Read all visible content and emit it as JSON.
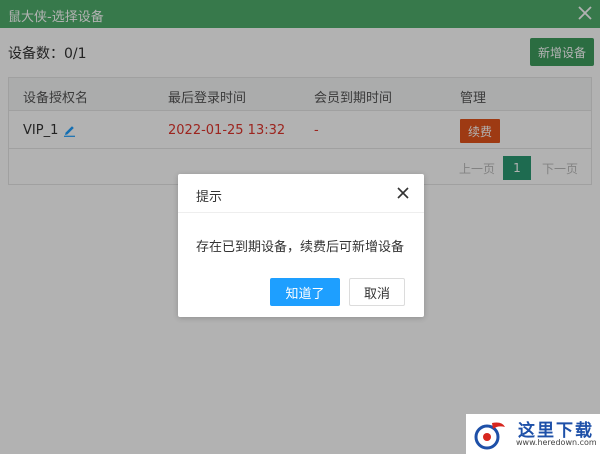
{
  "window": {
    "title": "鼠大侠-选择设备"
  },
  "header": {
    "count_label": "设备数：0/1",
    "add_button": "新增设备"
  },
  "table": {
    "columns": [
      "设备授权名",
      "最后登录时间",
      "会员到期时间",
      "管理"
    ],
    "rows": [
      {
        "name": "VIP_1",
        "last_login": "2022-01-25 13:32",
        "expire": "-",
        "action": "续费"
      }
    ]
  },
  "pagination": {
    "prev": "上一页",
    "current": "1",
    "next": "下一页"
  },
  "dialog": {
    "title": "提示",
    "message": "存在已到期设备，续费后可新增设备",
    "ok": "知道了",
    "cancel": "取消"
  },
  "watermark": {
    "name": "这里下载",
    "url": "www.heredown.com"
  },
  "colors": {
    "titlebar": "#4fae6c",
    "primary": "#1e9fff",
    "renew": "#e2531c",
    "page_active": "#2b9a73",
    "expired_text": "#e0342b"
  }
}
